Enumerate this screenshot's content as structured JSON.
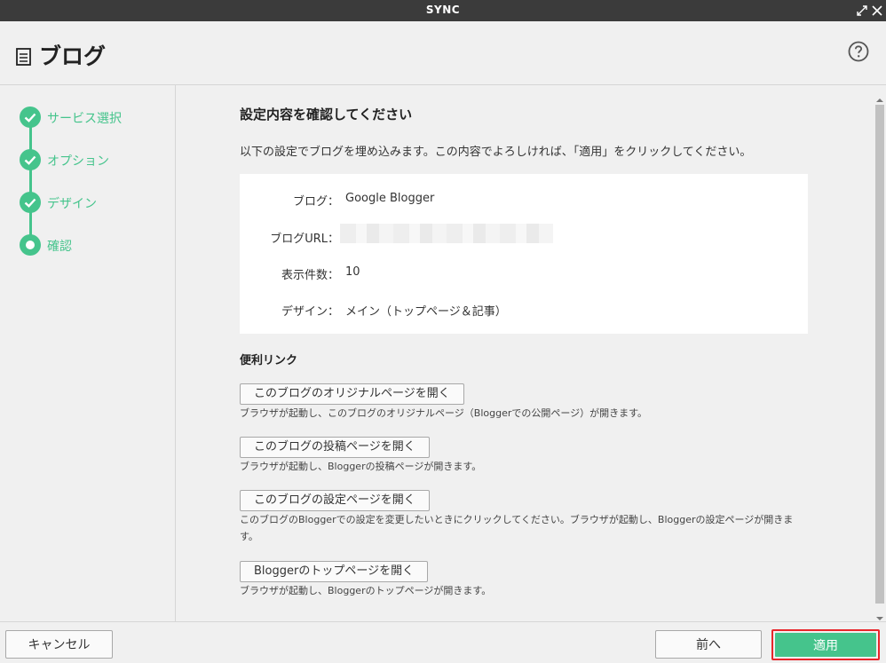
{
  "window": {
    "title": "SYNC"
  },
  "header": {
    "title": "ブログ"
  },
  "steps": [
    {
      "label": "サービス選択",
      "state": "done"
    },
    {
      "label": "オプション",
      "state": "done"
    },
    {
      "label": "デザイン",
      "state": "done"
    },
    {
      "label": "確認",
      "state": "current"
    }
  ],
  "main": {
    "title": "設定内容を確認してください",
    "description": "以下の設定でブログを埋め込みます。この内容でよろしければ、「適用」をクリックしてください。",
    "summary": [
      {
        "key": "ブログ：",
        "value": "Google Blogger"
      },
      {
        "key": "ブログURL：",
        "value": ""
      },
      {
        "key": "表示件数：",
        "value": "10"
      },
      {
        "key": "デザイン：",
        "value": "メイン（トップページ＆記事）"
      }
    ],
    "links_title": "便利リンク",
    "links": [
      {
        "label": "このブログのオリジナルページを開く",
        "desc": "ブラウザが起動し、このブログのオリジナルページ（Bloggerでの公開ページ）が開きます。"
      },
      {
        "label": "このブログの投稿ページを開く",
        "desc": "ブラウザが起動し、Bloggerの投稿ページが開きます。"
      },
      {
        "label": "このブログの設定ページを開く",
        "desc": "このブログのBloggerでの設定を変更したいときにクリックしてください。ブラウザが起動し、Bloggerの設定ページが開きます。"
      },
      {
        "label": "Bloggerのトップページを開く",
        "desc": "ブラウザが起動し、Bloggerのトップページが開きます。"
      }
    ]
  },
  "footer": {
    "cancel": "キャンセル",
    "back": "前へ",
    "apply": "適用"
  },
  "colors": {
    "accent": "#45c48c",
    "highlight": "#e8262b",
    "titlebar": "#3b3b3b"
  },
  "icons": {
    "page": "document-icon",
    "help": "help-icon",
    "expand": "expand-icon",
    "close": "close-icon",
    "check": "check-icon"
  }
}
